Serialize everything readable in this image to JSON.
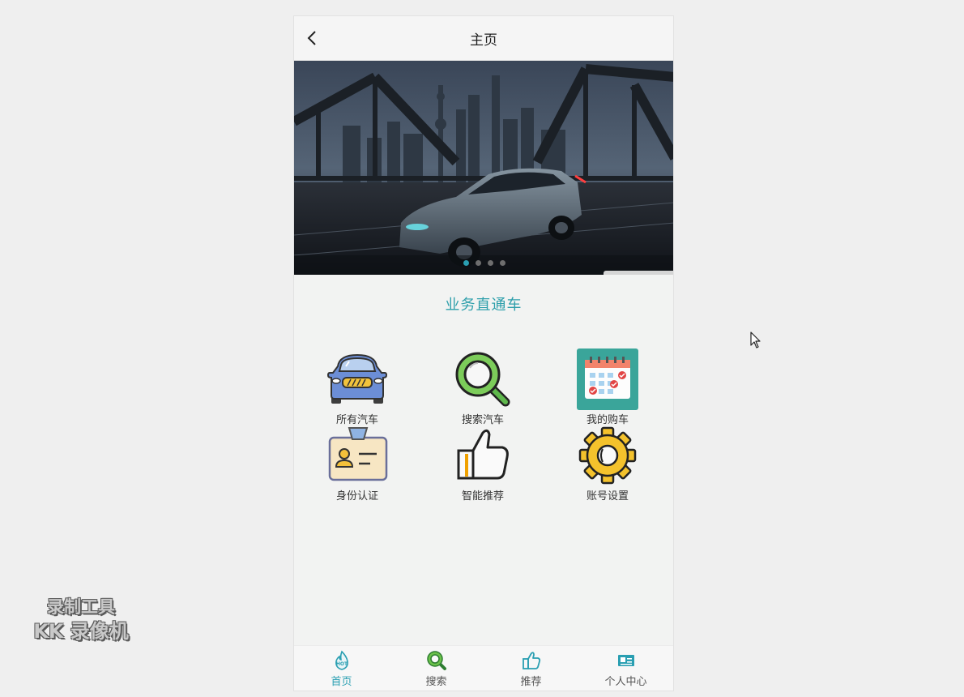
{
  "navbar": {
    "title": "主页"
  },
  "banner": {
    "slide_count": 4,
    "active_index": 0
  },
  "section": {
    "title": "业务直通车"
  },
  "grid": [
    {
      "label": "所有汽车",
      "icon": "car-icon"
    },
    {
      "label": "搜索汽车",
      "icon": "magnifier-icon"
    },
    {
      "label": "我的购车",
      "icon": "calendar-icon"
    },
    {
      "label": "身份认证",
      "icon": "id-card-icon"
    },
    {
      "label": "智能推荐",
      "icon": "thumbs-up-icon"
    },
    {
      "label": "账号设置",
      "icon": "gear-icon"
    }
  ],
  "tabbar": [
    {
      "label": "首页",
      "icon": "hot-flame-icon",
      "active": true
    },
    {
      "label": "搜索",
      "icon": "search-icon",
      "active": false
    },
    {
      "label": "推荐",
      "icon": "thumbs-up-icon",
      "active": false
    },
    {
      "label": "个人中心",
      "icon": "profile-card-icon",
      "active": false
    }
  ],
  "watermark": {
    "line1": "录制工具",
    "line2": "KK 录像机"
  },
  "colors": {
    "accent": "#2a9fb2",
    "background": "#f2f3f2"
  }
}
